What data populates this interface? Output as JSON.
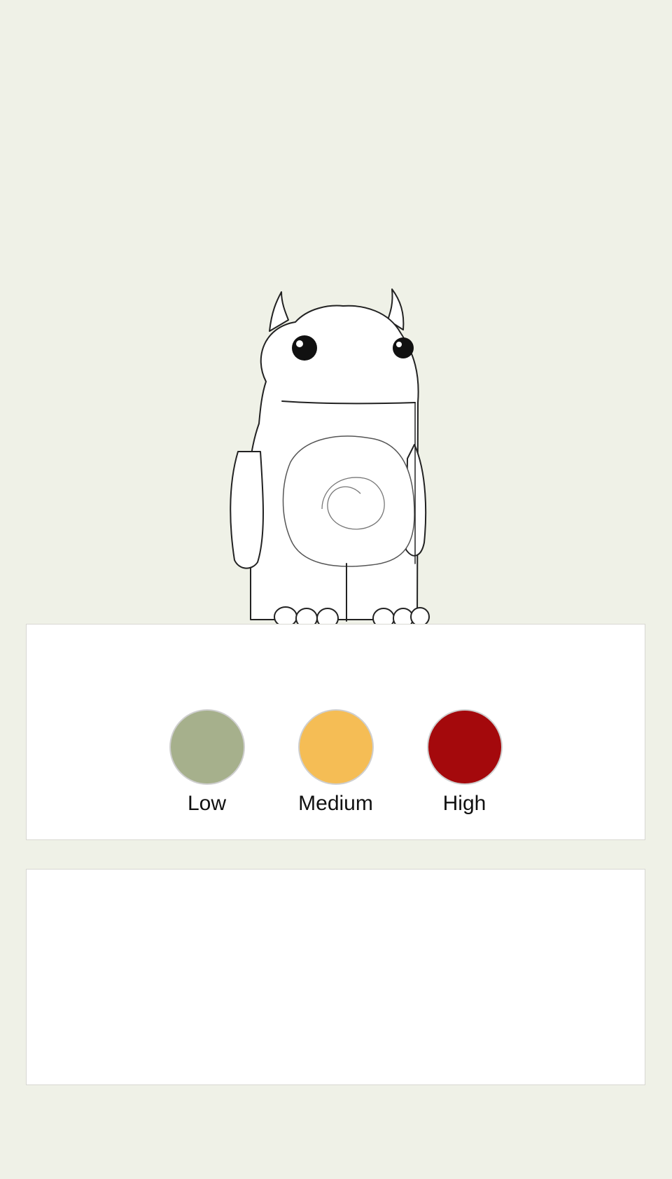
{
  "colors": {
    "background": "#eff1e7",
    "panel": "#ffffff"
  },
  "mascot": {
    "icon": "monster-illustration"
  },
  "severity": {
    "levels": [
      {
        "label": "Low",
        "color": "#a6b08c"
      },
      {
        "label": "Medium",
        "color": "#f5bd55"
      },
      {
        "label": "High",
        "color": "#a4090c"
      }
    ]
  }
}
